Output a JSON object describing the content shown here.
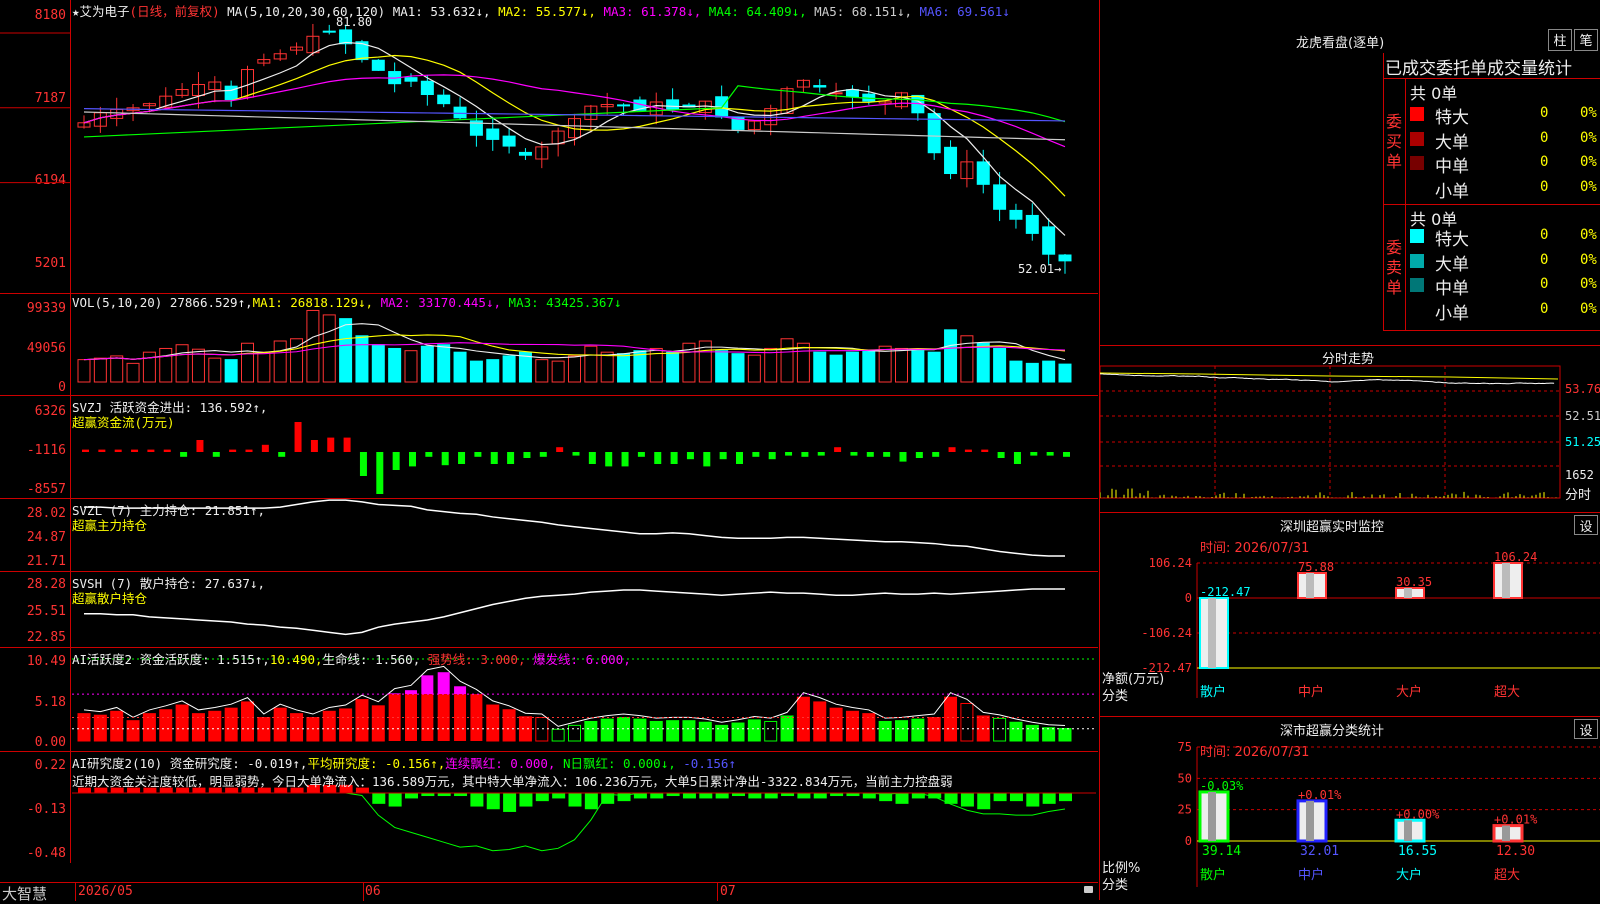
{
  "stock": {
    "name": "艾为电子",
    "mode": "(日线，前复权)"
  },
  "price_panel": {
    "ma_header": "MA(5,10,20,30,60,120)",
    "ma_values": [
      {
        "label": "MA1: 53.632↓,",
        "color": "#eeeeee"
      },
      {
        "label": "MA2: 55.577↓,",
        "color": "#ffff00"
      },
      {
        "label": "MA3: 61.378↓,",
        "color": "#ff00ff"
      },
      {
        "label": "MA4: 64.409↓,",
        "color": "#00ff00"
      },
      {
        "label": "MA5: 68.151↓,",
        "color": "#cccccc"
      },
      {
        "label": "MA6: 69.561↓",
        "color": "#5555ff"
      }
    ],
    "y_ticks": [
      "8180",
      "7187",
      "6194",
      "5201"
    ],
    "high_label": "81.80",
    "low_label": "52.01"
  },
  "vol_panel": {
    "title": "VOL(5,10,20)",
    "value": "27866.529↑,",
    "ma1": "MA1: 26818.129↓,",
    "ma2": "MA2: 33170.445↓,",
    "ma3": "MA3: 43425.367↓",
    "y_ticks": [
      "99339",
      "49056",
      "0"
    ]
  },
  "svzj_panel": {
    "title": "SVZJ  活跃资金进出: 136.592↑,",
    "subtitle": "超赢资金流(万元)",
    "y_ticks": [
      "6326",
      "-1116",
      "-8557"
    ]
  },
  "svzl_panel": {
    "title": "SVZL (7) 主力持仓: 21.851↑,",
    "subtitle": "超赢主力持仓",
    "y_ticks": [
      "28.02",
      "24.87",
      "21.71"
    ]
  },
  "svsh_panel": {
    "title": "SVSH (7) 散户持仓: 27.637↓,",
    "subtitle": "超赢散户持仓",
    "y_ticks": [
      "28.28",
      "25.51",
      "22.85"
    ]
  },
  "ai_active_panel": {
    "t1": "AI活跃度2 资金活跃度: 1.515↑,",
    "t2": "10.490,",
    "t3": "生命线: 1.560,",
    "t4": "强势线: 3.000,",
    "t5": "爆发线: 6.000,",
    "y_ticks": [
      "10.49",
      "5.18",
      "0.00"
    ]
  },
  "ai_research_panel": {
    "t1": "AI研究度2(10) 资金研究度: -0.019↑,",
    "t2": "平均研究度: -0.156↑,",
    "t3": "连续飘红: 0.000,",
    "t4": "N日飘红: 0.000↓,",
    "t5": "-0.156↑",
    "note": "近期大资金关注度较低，明显弱势，今日大单净流入：136.589万元，其中特大单净流入：106.236万元，大单5日累计净出-3322.834万元，当前主力控盘弱",
    "y_ticks": [
      "0.22",
      "-0.13",
      "-0.48"
    ]
  },
  "bottom": {
    "brand": "大智慧",
    "dates": [
      "2026/05",
      "06",
      "07"
    ]
  },
  "dragon": {
    "title": "龙虎看盘(逐单)",
    "btn1": "柱",
    "btn2": "笔",
    "header": "已成交委托单成交量统计",
    "buy": {
      "label": "委买单",
      "total": "共 0单",
      "rows": [
        {
          "name": "特大",
          "count": "0",
          "pct": "0%",
          "color": "#ff0000"
        },
        {
          "name": "大单",
          "count": "0",
          "pct": "0%",
          "color": "#aa0000"
        },
        {
          "name": "中单",
          "count": "0",
          "pct": "0%",
          "color": "#770000"
        },
        {
          "name": "小单",
          "count": "0",
          "pct": "0%",
          "color": "#000000"
        }
      ]
    },
    "sell": {
      "label": "委卖单",
      "total": "共 0单",
      "rows": [
        {
          "name": "特大",
          "count": "0",
          "pct": "0%",
          "color": "#00ffff"
        },
        {
          "name": "大单",
          "count": "0",
          "pct": "0%",
          "color": "#00aaaa"
        },
        {
          "name": "中单",
          "count": "0",
          "pct": "0%",
          "color": "#007777"
        },
        {
          "name": "小单",
          "count": "0",
          "pct": "0%",
          "color": "#000000"
        }
      ]
    }
  },
  "intraday": {
    "title": "分时走势",
    "y_ticks": [
      "53.76",
      "52.51",
      "51.25"
    ],
    "vol_label": "1652",
    "unit": "分时"
  },
  "sz_monitor": {
    "title": "深圳超赢实时监控",
    "setting_btn": "设",
    "time": "时间: 2026/07/31",
    "y_ticks": [
      "106.24",
      "0",
      "-106.24",
      "-212.47"
    ],
    "unit": "净额(万元)",
    "cat_label": "分类",
    "chart_data": {
      "type": "bar",
      "categories": [
        "散户",
        "中户",
        "大户",
        "超大"
      ],
      "values": [
        -212.47,
        75.88,
        30.35,
        106.24
      ],
      "ylim": [
        -212.47,
        106.24
      ]
    }
  },
  "sz_class": {
    "title": "深市超赢分类统计",
    "setting_btn": "设",
    "time": "时间: 2026/07/31",
    "y_ticks": [
      "75",
      "50",
      "25",
      "0"
    ],
    "unit": "比例%",
    "cat_label": "分类",
    "chart_data": {
      "type": "bar",
      "categories": [
        "散户",
        "中户",
        "大户",
        "超大"
      ],
      "values": [
        39.14,
        32.01,
        16.55,
        12.3
      ],
      "changes": [
        "-0.03%",
        "+0.01%",
        "+0.00%",
        "+0.01%"
      ],
      "ylim": [
        0,
        75
      ]
    }
  }
}
